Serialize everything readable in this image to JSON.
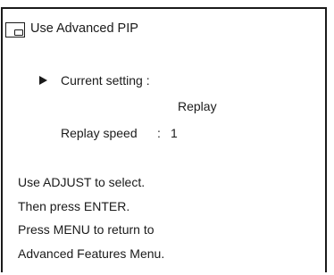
{
  "menu": {
    "title": "Use Advanced PIP",
    "current_setting_label": "Current setting :",
    "current_setting_value": "Replay",
    "replay_speed_label": "Replay speed",
    "replay_speed_separator": ":",
    "replay_speed_value": "1"
  },
  "instructions": {
    "line1": "Use ADJUST to select.",
    "line2": "Then press ENTER.",
    "line3": "Press MENU to return to",
    "line4": "Advanced Features Menu."
  },
  "icons": {
    "title": "pip-window-icon",
    "pointer": "triangle-pointer-icon"
  }
}
